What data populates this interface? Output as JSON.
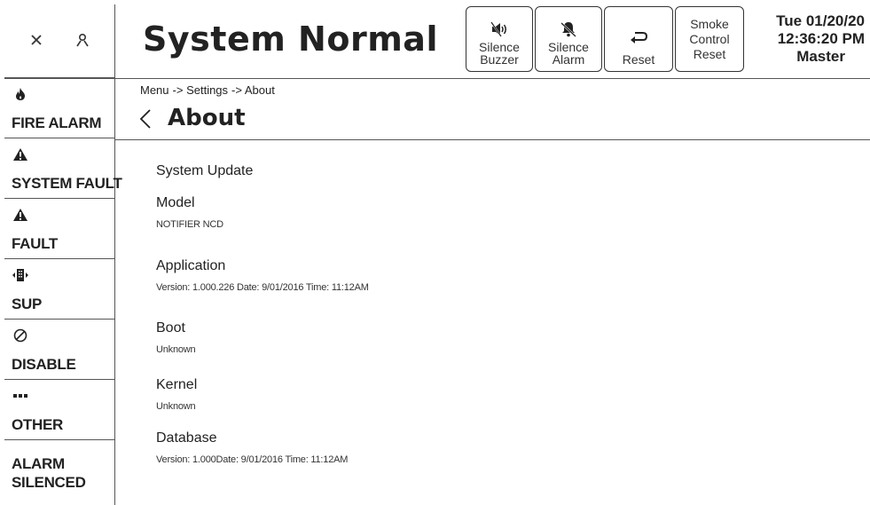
{
  "header": {
    "status": "System Normal",
    "buttons": {
      "silence_buzzer": "Silence\nBuzzer",
      "silence_alarm": "Silence\nAlarm",
      "reset": "Reset",
      "smoke_control_reset": "Smoke\nControl\nReset"
    },
    "datetime": {
      "date": "Tue 01/20/20",
      "time": "12:36:20 PM",
      "role": "Master"
    },
    "corner_icons": [
      "close-icon",
      "user-icon"
    ]
  },
  "sidebar": {
    "items": [
      {
        "label": "FIRE ALARM",
        "icon": "flame-icon"
      },
      {
        "label": "SYSTEM FAULT",
        "icon": "warning-icon"
      },
      {
        "label": "FAULT",
        "icon": "warning-icon"
      },
      {
        "label": "SUP",
        "icon": "supervisory-icon"
      },
      {
        "label": "DISABLE",
        "icon": "disable-icon"
      },
      {
        "label": "OTHER",
        "icon": "more-icon"
      },
      {
        "label": "ALARM\nSILENCED",
        "icon": ""
      }
    ]
  },
  "breadcrumb": [
    "Menu",
    "-> Settings",
    "-> About"
  ],
  "page": {
    "title": "About",
    "section": "System Update",
    "fields": [
      {
        "label": "Model",
        "value": "NOTIFIER NCD"
      },
      {
        "label": "Application",
        "value": "Version: 1.000.226 Date: 9/01/2016 Time: 11:12AM"
      },
      {
        "label": "Boot",
        "value": "Unknown"
      },
      {
        "label": "Kernel",
        "value": "Unknown"
      },
      {
        "label": "Database",
        "value": "Version: 1.000Date: 9/01/2016 Time: 11:12AM"
      }
    ]
  },
  "colors": {
    "text": "#222222",
    "border": "#555555",
    "background": "#ffffff"
  }
}
